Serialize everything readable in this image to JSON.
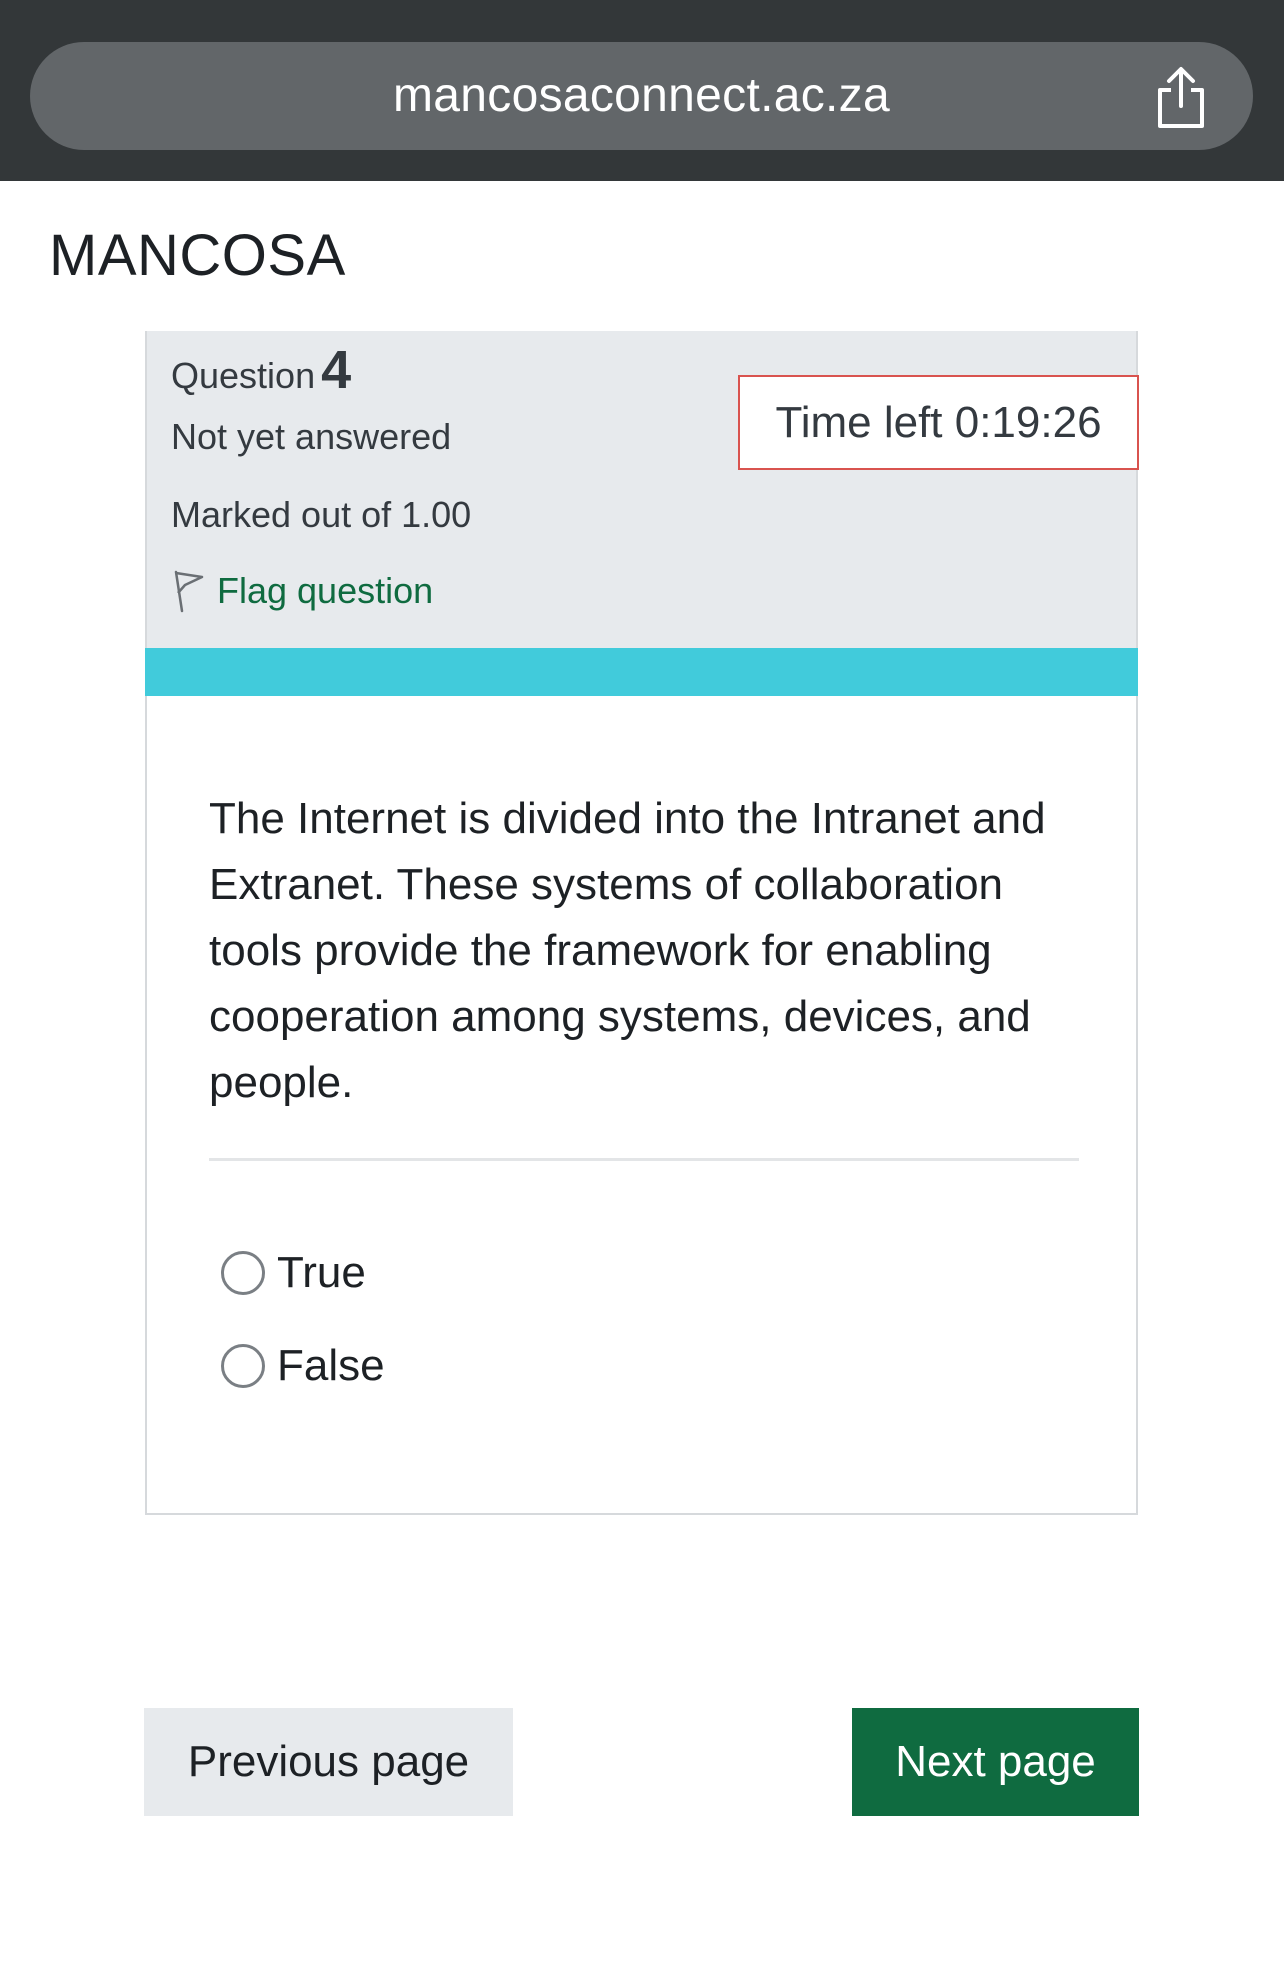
{
  "browser": {
    "url": "mancosaconnect.ac.za",
    "share_icon": "share-icon"
  },
  "header": {
    "brand": "MANCOSA"
  },
  "question_info": {
    "label": "Question",
    "number": "4",
    "state": "Not yet answered",
    "grade": "Marked out of 1.00",
    "flag_label": "Flag question",
    "flag_icon": "flag-icon"
  },
  "timer": {
    "text": "Time left 0:19:26"
  },
  "question": {
    "text": "The Internet is divided into the Intranet and Extranet. These systems of collaboration tools provide the framework for enabling cooperation among systems, devices, and people.",
    "options": [
      {
        "label": "True",
        "selected": false
      },
      {
        "label": "False",
        "selected": false
      }
    ]
  },
  "navigation": {
    "previous_label": "Previous page",
    "next_label": "Next page"
  },
  "colors": {
    "browser_bar": "#333739",
    "url_pill": "#626669",
    "info_panel": "#e7eaed",
    "timer_border": "#d9534f",
    "accent_bar": "#41cbdb",
    "link_green": "#0f6b40",
    "next_button": "#0f6b40",
    "previous_button": "#e7eaed"
  }
}
